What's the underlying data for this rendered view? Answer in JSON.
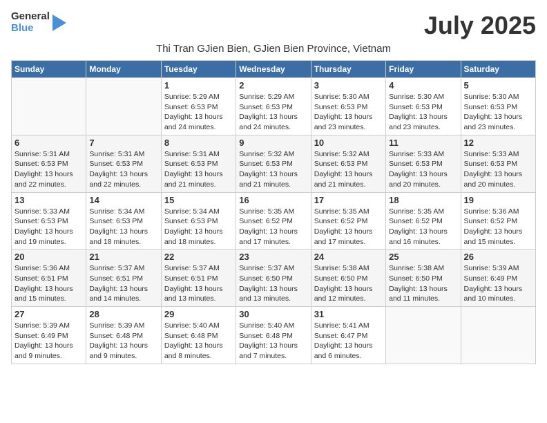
{
  "logo": {
    "text_general": "General",
    "text_blue": "Blue"
  },
  "title": "July 2025",
  "location": "Thi Tran GJien Bien, GJien Bien Province, Vietnam",
  "weekdays": [
    "Sunday",
    "Monday",
    "Tuesday",
    "Wednesday",
    "Thursday",
    "Friday",
    "Saturday"
  ],
  "weeks": [
    [
      {
        "day": "",
        "empty": true
      },
      {
        "day": "",
        "empty": true
      },
      {
        "day": "1",
        "sunrise": "Sunrise: 5:29 AM",
        "sunset": "Sunset: 6:53 PM",
        "daylight": "Daylight: 13 hours and 24 minutes."
      },
      {
        "day": "2",
        "sunrise": "Sunrise: 5:29 AM",
        "sunset": "Sunset: 6:53 PM",
        "daylight": "Daylight: 13 hours and 24 minutes."
      },
      {
        "day": "3",
        "sunrise": "Sunrise: 5:30 AM",
        "sunset": "Sunset: 6:53 PM",
        "daylight": "Daylight: 13 hours and 23 minutes."
      },
      {
        "day": "4",
        "sunrise": "Sunrise: 5:30 AM",
        "sunset": "Sunset: 6:53 PM",
        "daylight": "Daylight: 13 hours and 23 minutes."
      },
      {
        "day": "5",
        "sunrise": "Sunrise: 5:30 AM",
        "sunset": "Sunset: 6:53 PM",
        "daylight": "Daylight: 13 hours and 23 minutes."
      }
    ],
    [
      {
        "day": "6",
        "sunrise": "Sunrise: 5:31 AM",
        "sunset": "Sunset: 6:53 PM",
        "daylight": "Daylight: 13 hours and 22 minutes."
      },
      {
        "day": "7",
        "sunrise": "Sunrise: 5:31 AM",
        "sunset": "Sunset: 6:53 PM",
        "daylight": "Daylight: 13 hours and 22 minutes."
      },
      {
        "day": "8",
        "sunrise": "Sunrise: 5:31 AM",
        "sunset": "Sunset: 6:53 PM",
        "daylight": "Daylight: 13 hours and 21 minutes."
      },
      {
        "day": "9",
        "sunrise": "Sunrise: 5:32 AM",
        "sunset": "Sunset: 6:53 PM",
        "daylight": "Daylight: 13 hours and 21 minutes."
      },
      {
        "day": "10",
        "sunrise": "Sunrise: 5:32 AM",
        "sunset": "Sunset: 6:53 PM",
        "daylight": "Daylight: 13 hours and 21 minutes."
      },
      {
        "day": "11",
        "sunrise": "Sunrise: 5:33 AM",
        "sunset": "Sunset: 6:53 PM",
        "daylight": "Daylight: 13 hours and 20 minutes."
      },
      {
        "day": "12",
        "sunrise": "Sunrise: 5:33 AM",
        "sunset": "Sunset: 6:53 PM",
        "daylight": "Daylight: 13 hours and 20 minutes."
      }
    ],
    [
      {
        "day": "13",
        "sunrise": "Sunrise: 5:33 AM",
        "sunset": "Sunset: 6:53 PM",
        "daylight": "Daylight: 13 hours and 19 minutes."
      },
      {
        "day": "14",
        "sunrise": "Sunrise: 5:34 AM",
        "sunset": "Sunset: 6:53 PM",
        "daylight": "Daylight: 13 hours and 18 minutes."
      },
      {
        "day": "15",
        "sunrise": "Sunrise: 5:34 AM",
        "sunset": "Sunset: 6:53 PM",
        "daylight": "Daylight: 13 hours and 18 minutes."
      },
      {
        "day": "16",
        "sunrise": "Sunrise: 5:35 AM",
        "sunset": "Sunset: 6:52 PM",
        "daylight": "Daylight: 13 hours and 17 minutes."
      },
      {
        "day": "17",
        "sunrise": "Sunrise: 5:35 AM",
        "sunset": "Sunset: 6:52 PM",
        "daylight": "Daylight: 13 hours and 17 minutes."
      },
      {
        "day": "18",
        "sunrise": "Sunrise: 5:35 AM",
        "sunset": "Sunset: 6:52 PM",
        "daylight": "Daylight: 13 hours and 16 minutes."
      },
      {
        "day": "19",
        "sunrise": "Sunrise: 5:36 AM",
        "sunset": "Sunset: 6:52 PM",
        "daylight": "Daylight: 13 hours and 15 minutes."
      }
    ],
    [
      {
        "day": "20",
        "sunrise": "Sunrise: 5:36 AM",
        "sunset": "Sunset: 6:51 PM",
        "daylight": "Daylight: 13 hours and 15 minutes."
      },
      {
        "day": "21",
        "sunrise": "Sunrise: 5:37 AM",
        "sunset": "Sunset: 6:51 PM",
        "daylight": "Daylight: 13 hours and 14 minutes."
      },
      {
        "day": "22",
        "sunrise": "Sunrise: 5:37 AM",
        "sunset": "Sunset: 6:51 PM",
        "daylight": "Daylight: 13 hours and 13 minutes."
      },
      {
        "day": "23",
        "sunrise": "Sunrise: 5:37 AM",
        "sunset": "Sunset: 6:50 PM",
        "daylight": "Daylight: 13 hours and 13 minutes."
      },
      {
        "day": "24",
        "sunrise": "Sunrise: 5:38 AM",
        "sunset": "Sunset: 6:50 PM",
        "daylight": "Daylight: 13 hours and 12 minutes."
      },
      {
        "day": "25",
        "sunrise": "Sunrise: 5:38 AM",
        "sunset": "Sunset: 6:50 PM",
        "daylight": "Daylight: 13 hours and 11 minutes."
      },
      {
        "day": "26",
        "sunrise": "Sunrise: 5:39 AM",
        "sunset": "Sunset: 6:49 PM",
        "daylight": "Daylight: 13 hours and 10 minutes."
      }
    ],
    [
      {
        "day": "27",
        "sunrise": "Sunrise: 5:39 AM",
        "sunset": "Sunset: 6:49 PM",
        "daylight": "Daylight: 13 hours and 9 minutes."
      },
      {
        "day": "28",
        "sunrise": "Sunrise: 5:39 AM",
        "sunset": "Sunset: 6:48 PM",
        "daylight": "Daylight: 13 hours and 9 minutes."
      },
      {
        "day": "29",
        "sunrise": "Sunrise: 5:40 AM",
        "sunset": "Sunset: 6:48 PM",
        "daylight": "Daylight: 13 hours and 8 minutes."
      },
      {
        "day": "30",
        "sunrise": "Sunrise: 5:40 AM",
        "sunset": "Sunset: 6:48 PM",
        "daylight": "Daylight: 13 hours and 7 minutes."
      },
      {
        "day": "31",
        "sunrise": "Sunrise: 5:41 AM",
        "sunset": "Sunset: 6:47 PM",
        "daylight": "Daylight: 13 hours and 6 minutes."
      },
      {
        "day": "",
        "empty": true
      },
      {
        "day": "",
        "empty": true
      }
    ]
  ]
}
